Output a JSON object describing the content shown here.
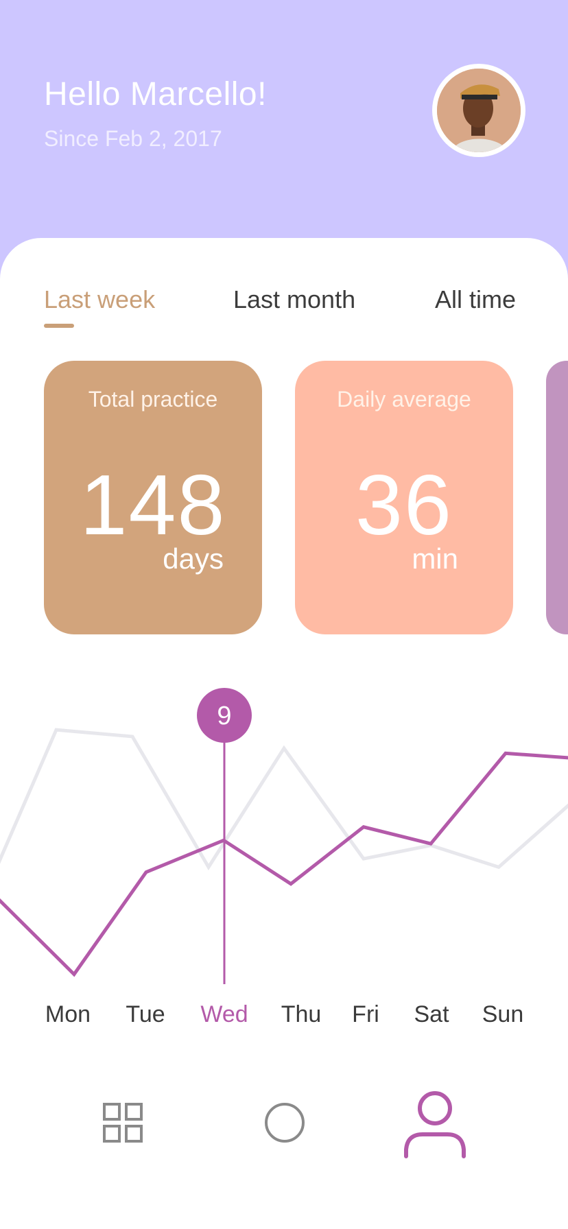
{
  "header": {
    "greeting": "Hello Marcello!",
    "since": "Since Feb 2, 2017"
  },
  "tabs": [
    {
      "label": "Last week",
      "active": true
    },
    {
      "label": "Last month",
      "active": false
    },
    {
      "label": "All time",
      "active": false
    }
  ],
  "cards": [
    {
      "title": "Total practice",
      "value": "148",
      "unit": "days",
      "color": "#d2a47c"
    },
    {
      "title": "Daily average",
      "value": "36",
      "unit": "min",
      "color": "#ffbba4"
    },
    {
      "title": "",
      "value": "",
      "unit": "",
      "color": "#c194bf"
    }
  ],
  "chart_data": {
    "type": "line",
    "categories": [
      "Mon",
      "Tue",
      "Wed",
      "Thu",
      "Fri",
      "Sat",
      "Sun"
    ],
    "selected_index": 2,
    "selected_label": "9",
    "series": [
      {
        "values": [
          1,
          7.1,
          9,
          6.4,
          9.8,
          8.8,
          14.2
        ],
        "color": "#b35aa9"
      },
      {
        "values": [
          15.6,
          15.2,
          7.4,
          14.5,
          7.9,
          8.7,
          7.4
        ],
        "color": "#e7e7ec"
      }
    ],
    "ylim": [
      0,
      17
    ]
  },
  "nav": {
    "items": [
      {
        "icon": "grid-icon",
        "active": false
      },
      {
        "icon": "circle-icon",
        "active": false
      },
      {
        "icon": "profile-icon",
        "active": true
      }
    ]
  }
}
